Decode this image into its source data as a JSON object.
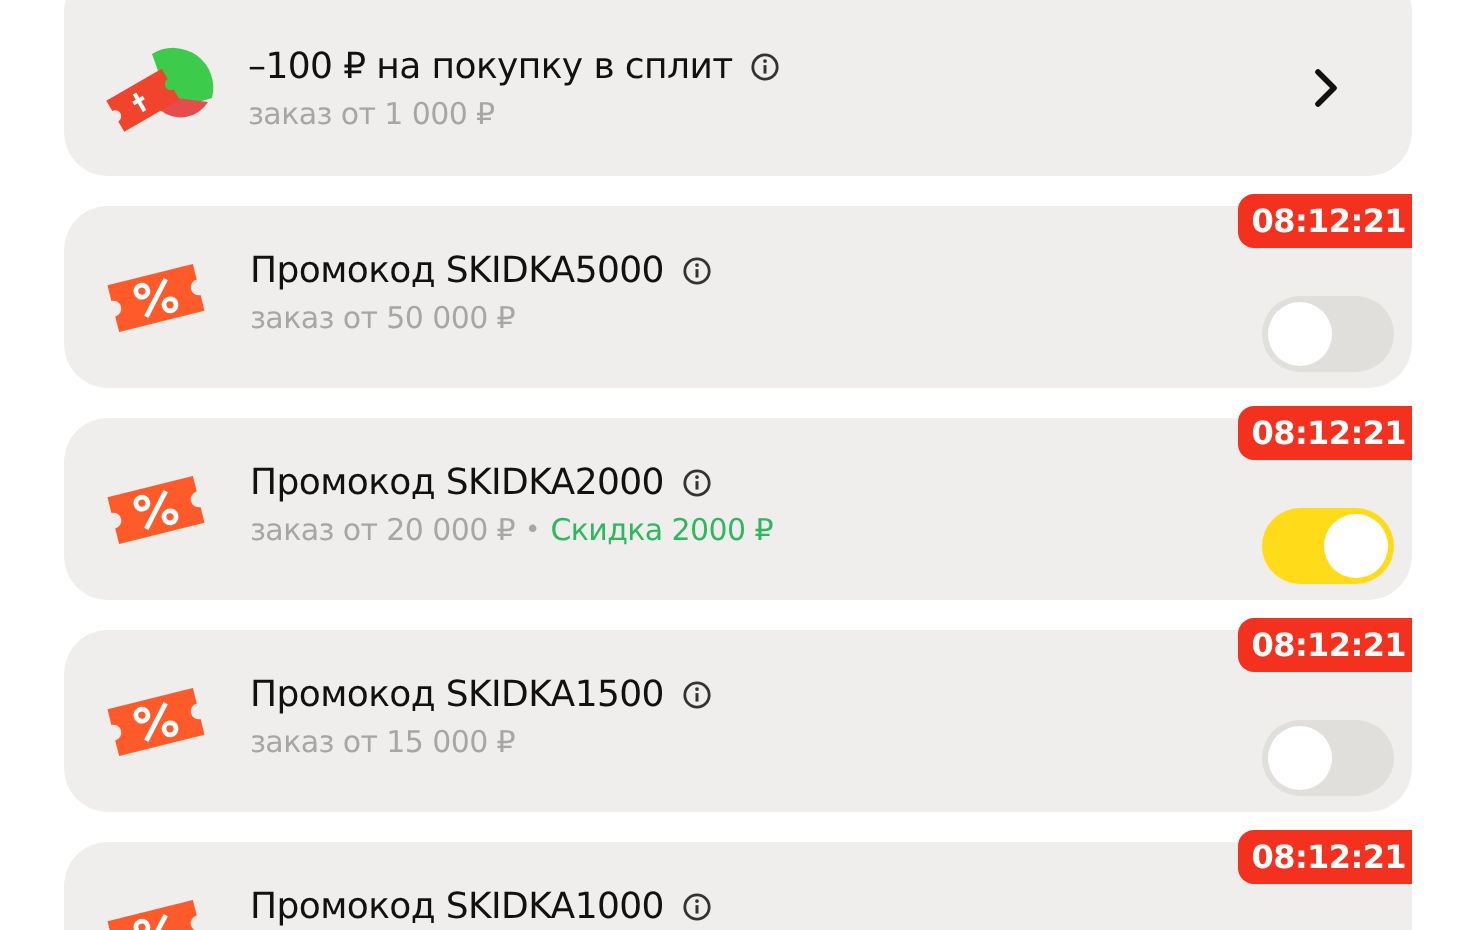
{
  "split_offer": {
    "title": "–100 ₽ на покупку в сплит",
    "condition": "заказ от 1 000 ₽"
  },
  "promos": [
    {
      "title": "Промокод SKIDKA5000",
      "condition": "заказ от 50 000 ₽",
      "timer": "08:12:21",
      "on": false
    },
    {
      "title": "Промокод SKIDKA2000",
      "condition": "заказ от 20 000 ₽",
      "separator": "•",
      "discount": "Скидка 2000 ₽",
      "timer": "08:12:21",
      "on": true
    },
    {
      "title": "Промокод SKIDKA1500",
      "condition": "заказ от 15 000 ₽",
      "timer": "08:12:21",
      "on": false
    },
    {
      "title": "Промокод SKIDKA1000",
      "timer": "08:12:21"
    }
  ]
}
